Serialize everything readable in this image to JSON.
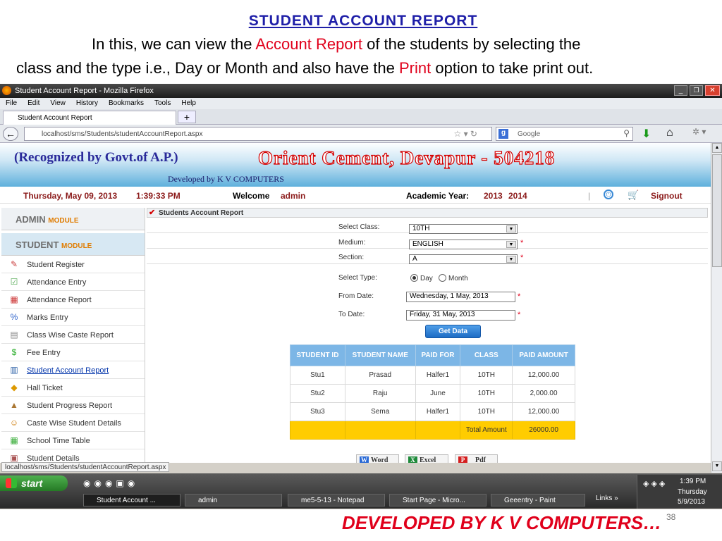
{
  "slide": {
    "title": "STUDENT ACCOUNT REPORT",
    "line1_a": "In this, we can view the ",
    "line1_b": "Account Report",
    "line1_c": " of the students by selecting the",
    "line2_a": "class and the type i.e., Day or Month and also have the ",
    "line2_b": "Print",
    "line2_c": " option to take print out.",
    "footer": "DEVELOPED BY K V COMPUTERS…",
    "slide_number": "38"
  },
  "browser": {
    "window_title": "Student Account Report - Mozilla Firefox",
    "menu": [
      "File",
      "Edit",
      "View",
      "History",
      "Bookmarks",
      "Tools",
      "Help"
    ],
    "tab_label": "Student Account Report",
    "url": "localhost/sms/Students/studentAccountReport.aspx",
    "search_engine": "Google",
    "status_url": "localhost/sms/Students/studentAccountReport.aspx"
  },
  "site": {
    "recognized": "(Recognized by Govt.of  A.P.)",
    "org": "Orient Cement, Devapur - 504218",
    "developed": "Developed by K V COMPUTERS",
    "date": "Thursday, May 09, 2013",
    "time": "1:39:33 PM",
    "welcome": "Welcome",
    "user": "admin",
    "year_label": "Academic Year:",
    "year_from": "2013",
    "year_to": "2014",
    "signout": "Signout"
  },
  "sidebar": {
    "admin_a": "ADMIN",
    "admin_b": "MODULE",
    "student_a": "STUDENT",
    "student_b": "MODULE",
    "items": [
      {
        "label": "Student Register",
        "icon": "pencil-icon"
      },
      {
        "label": "Attendance Entry",
        "icon": "checklist-icon"
      },
      {
        "label": "Attendance Report",
        "icon": "calendar-icon"
      },
      {
        "label": "Marks Entry",
        "icon": "percent-icon"
      },
      {
        "label": "Class Wise Caste Report",
        "icon": "document-icon"
      },
      {
        "label": "Fee Entry",
        "icon": "money-icon"
      },
      {
        "label": "Student Account Report",
        "icon": "report-icon"
      },
      {
        "label": "Hall Ticket",
        "icon": "ticket-icon"
      },
      {
        "label": "Student Progress Report",
        "icon": "chart-icon"
      },
      {
        "label": "Caste Wise Student Details",
        "icon": "people-icon"
      },
      {
        "label": "School Time Table",
        "icon": "table-icon"
      },
      {
        "label": "Student Details",
        "icon": "folder-icon"
      }
    ]
  },
  "form": {
    "panel_title": "Students Account Report",
    "class_label": "Select Class:",
    "class_value": "10TH",
    "medium_label": "Medium:",
    "medium_value": "ENGLISH",
    "section_label": "Section:",
    "section_value": "A",
    "type_label": "Select Type:",
    "type_day": "Day",
    "type_month": "Month",
    "from_label": "From Date:",
    "from_value": "Wednesday, 1 May, 2013",
    "to_label": "To Date:",
    "to_value": "Friday, 31 May, 2013",
    "get_data": "Get Data"
  },
  "table": {
    "headers": [
      "STUDENT ID",
      "STUDENT NAME",
      "PAID FOR",
      "CLASS",
      "PAID AMOUNT"
    ],
    "rows": [
      [
        "Stu1",
        "Prasad",
        "Halfer1",
        "10TH",
        "12,000.00"
      ],
      [
        "Stu2",
        "Raju",
        "June",
        "10TH",
        "2,000.00"
      ],
      [
        "Stu3",
        "Sema",
        "Halfer1",
        "10TH",
        "12,000.00"
      ]
    ],
    "total_label": "Total Amount",
    "total_value": "26000.00"
  },
  "export": {
    "word": "Word",
    "excel": "Excel",
    "pdf": "Pdf"
  },
  "taskbar": {
    "start": "start",
    "tasks": [
      "Student Account ...",
      "admin",
      "me5-5-13 - Notepad",
      "Start Page - Micro...",
      "Geeentry - Paint"
    ],
    "links": "Links",
    "clock_time": "1:39 PM",
    "clock_day": "Thursday",
    "clock_date": "5/9/2013"
  }
}
